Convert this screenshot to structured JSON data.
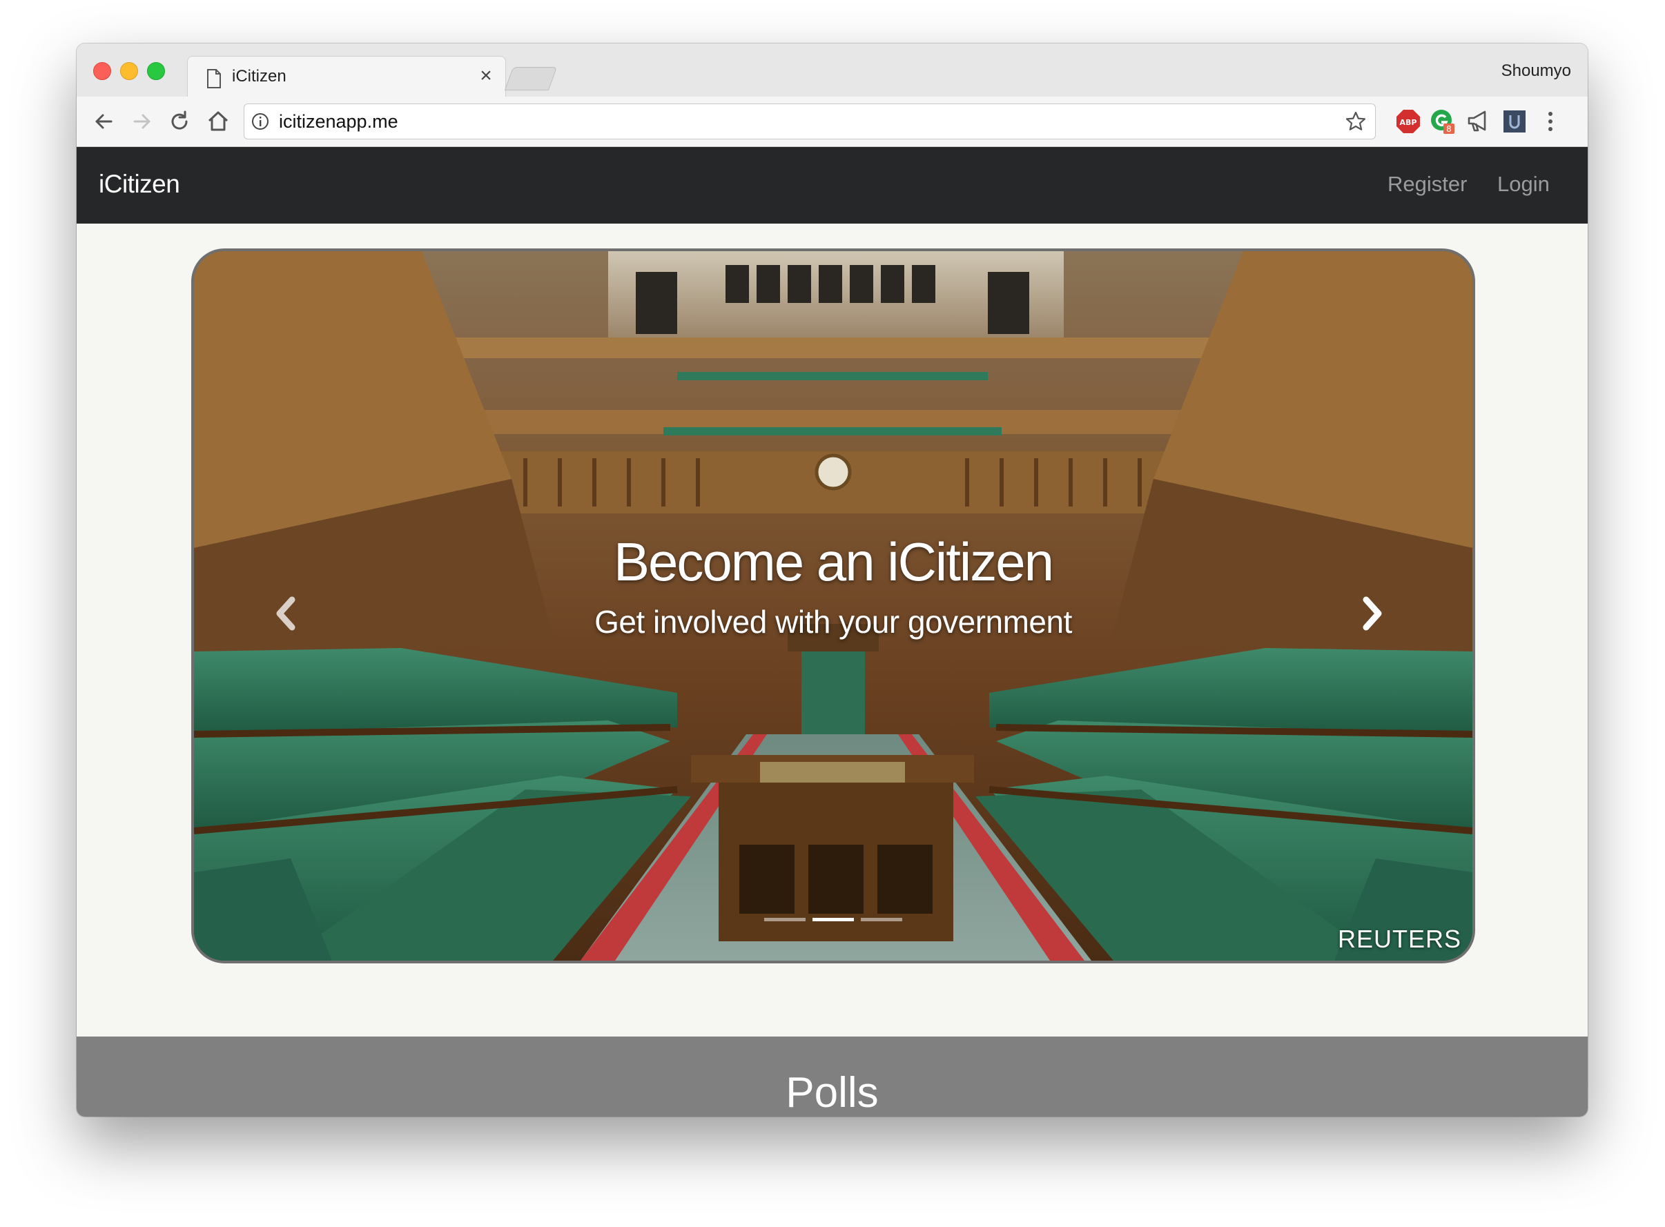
{
  "browser": {
    "tab_title": "iCitizen",
    "tab_close": "×",
    "profile_name": "Shoumyo",
    "url": "icitizenapp.me",
    "extensions": {
      "abp_label": "ABP",
      "badge_count": "8"
    }
  },
  "navbar": {
    "brand": "iCitizen",
    "links": [
      "Register",
      "Login"
    ]
  },
  "carousel": {
    "title": "Become an iCitizen",
    "subtitle": "Get involved with your government",
    "watermark": "REUTERS",
    "slide_count": 3,
    "active_slide": 2,
    "prev_icon": "chevron-left-icon",
    "next_icon": "chevron-right-icon"
  },
  "polls": {
    "title": "Polls"
  },
  "colors": {
    "navbar_bg": "#262728",
    "page_bg": "#f6f6f3",
    "polls_bg": "#808080",
    "nav_link": "#9b9c9c"
  }
}
